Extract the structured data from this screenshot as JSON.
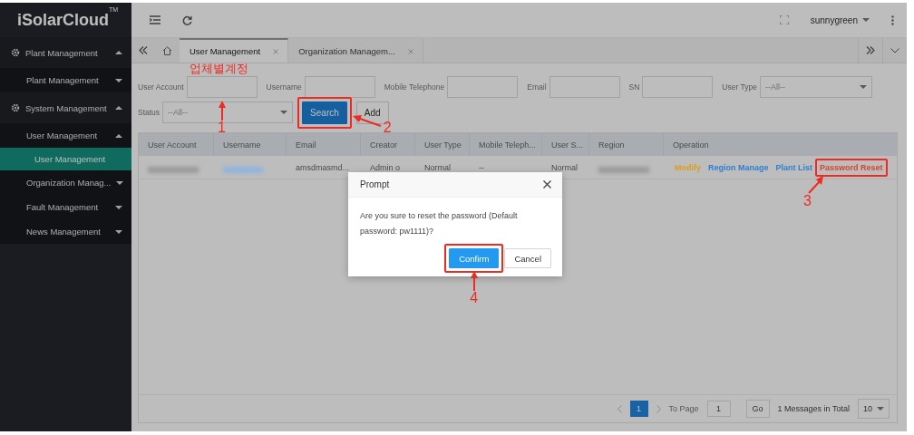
{
  "sidebar": {
    "logo": "iSolarCloud",
    "logo_mark": "TM",
    "items": [
      {
        "label": "Plant Management",
        "kind": "group",
        "expanded": true,
        "children": [
          {
            "label": "Plant Management",
            "kind": "menu",
            "expanded": false
          }
        ]
      },
      {
        "label": "System Management",
        "kind": "group",
        "expanded": true,
        "children": [
          {
            "label": "User Management",
            "kind": "menu",
            "expanded": true,
            "children": [
              {
                "label": "User Management",
                "kind": "page",
                "selected": true
              }
            ]
          },
          {
            "label": "Organization Manag...",
            "kind": "menu",
            "expanded": false
          },
          {
            "label": "Fault Management",
            "kind": "menu",
            "expanded": false
          },
          {
            "label": "News Management",
            "kind": "menu",
            "expanded": false
          }
        ]
      }
    ]
  },
  "toolbar": {
    "user": "sunnygreen"
  },
  "tabs": [
    {
      "label": "User Management",
      "selected": true
    },
    {
      "label": "Organization Managem...",
      "selected": false
    }
  ],
  "filters": [
    [
      {
        "label": "User Account",
        "kind": "text",
        "annotation": "업체별계정",
        "callout": {
          "number": "1"
        }
      },
      {
        "label": "Username",
        "kind": "text"
      },
      {
        "label": "Mobile Telephone",
        "kind": "text"
      },
      {
        "label": "Email",
        "kind": "text"
      },
      {
        "label": "SN",
        "kind": "text"
      },
      {
        "label": "User Type",
        "kind": "select",
        "value": "--All--"
      }
    ],
    [
      {
        "label": "Status",
        "kind": "select",
        "value": "--All--"
      }
    ]
  ],
  "filter_buttons": [
    {
      "label": "Search",
      "kind": "primary",
      "highlighted": true,
      "callout": {
        "number": "2"
      }
    },
    {
      "label": "Add",
      "kind": "default",
      "highlighted": false
    }
  ],
  "table": {
    "columns": [
      "User Account",
      "Username",
      "Email",
      "Creator",
      "User Type",
      "Mobile Teleph...",
      "User S...",
      "Region",
      "Operation"
    ],
    "rows": [
      {
        "cells": [
          {
            "kind": "blurred"
          },
          {
            "kind": "blurred-link"
          },
          {
            "kind": "text",
            "text": "amsdmasmd..."
          },
          {
            "kind": "text",
            "text": "Admin o"
          },
          {
            "kind": "text",
            "text": "Normal"
          },
          {
            "kind": "text",
            "text": "--"
          },
          {
            "kind": "text",
            "text": "Normal"
          },
          {
            "kind": "blurred"
          },
          {
            "kind": "actions",
            "actions": [
              {
                "label": "Modify",
                "color": "#d9a01e",
                "highlighted": false
              },
              {
                "label": "Region Manage",
                "color": "#2f7fd0",
                "highlighted": false
              },
              {
                "label": "Plant List",
                "color": "#2f7fd0",
                "highlighted": false
              },
              {
                "label": "Password Reset",
                "color": "#d6442a",
                "highlighted": true,
                "callout": {
                  "number": "3"
                }
              }
            ]
          }
        ]
      }
    ]
  },
  "pagination": {
    "pages": [
      {
        "label": "1",
        "selected": true
      }
    ],
    "goto_label": "To Page",
    "goto_value": "1",
    "go": "Go",
    "total": "1 Messages in Total",
    "page_size": "10"
  },
  "dialog": {
    "modal": true,
    "title": "Prompt",
    "message": "Are you sure to reset the password (Default password: pw1111)?",
    "buttons": [
      {
        "label": "Confirm",
        "kind": "primary",
        "highlighted": true,
        "callout": {
          "number": "4"
        }
      },
      {
        "label": "Cancel",
        "kind": "default",
        "highlighted": false
      }
    ]
  }
}
